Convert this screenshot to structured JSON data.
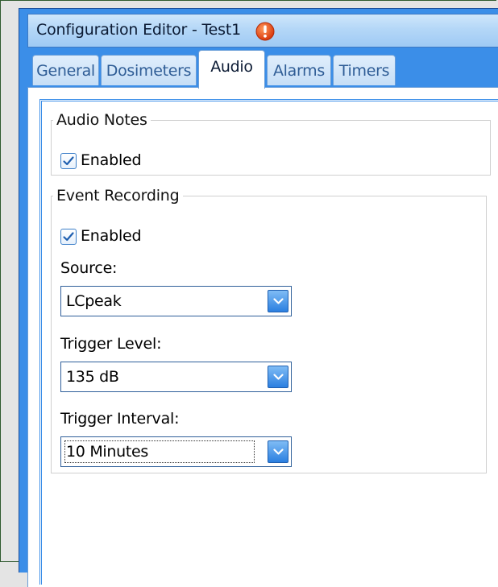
{
  "window": {
    "title": "Configuration Editor - Test1",
    "title_icon": "warning-alert-icon"
  },
  "tabs": [
    {
      "label": "General",
      "active": false
    },
    {
      "label": "Dosimeters",
      "active": false
    },
    {
      "label": "Audio",
      "active": true
    },
    {
      "label": "Alarms",
      "active": false
    },
    {
      "label": "Timers",
      "active": false
    }
  ],
  "audio_notes": {
    "legend": "Audio Notes",
    "enabled_label": "Enabled",
    "enabled": true
  },
  "event_recording": {
    "legend": "Event Recording",
    "enabled_label": "Enabled",
    "enabled": true,
    "source_label": "Source:",
    "source_value": "LCpeak",
    "trigger_level_label": "Trigger Level:",
    "trigger_level_value": "135 dB",
    "trigger_interval_label": "Trigger Interval:",
    "trigger_interval_value": "10 Minutes"
  },
  "colors": {
    "accent": "#3b8ee8",
    "titlebar": "#b4d7f7",
    "alert": "#e8501c"
  }
}
